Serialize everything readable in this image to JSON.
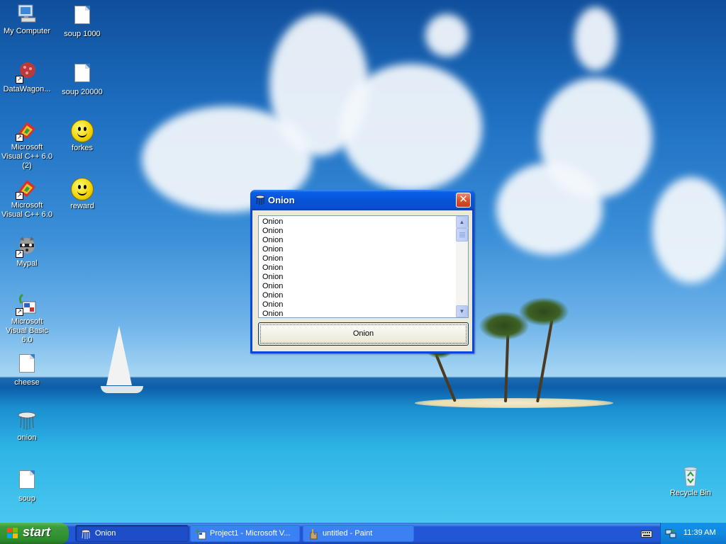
{
  "desktop": {
    "icons": [
      {
        "label": "My Computer"
      },
      {
        "label": "soup 1000"
      },
      {
        "label": "DataWagon..."
      },
      {
        "label": "soup 20000"
      },
      {
        "label": "Microsoft Visual C++ 6.0 (2)"
      },
      {
        "label": "forkes"
      },
      {
        "label": "Microsoft Visual C++ 6.0"
      },
      {
        "label": "reward"
      },
      {
        "label": "Mypal"
      },
      {
        "label": "Microsoft Visual Basic 6.0"
      },
      {
        "label": "cheese"
      },
      {
        "label": "onion"
      },
      {
        "label": "soup"
      },
      {
        "label": "Recycle Bin"
      }
    ]
  },
  "window": {
    "title": "Onion",
    "close_symbol": "✕",
    "list_items": [
      "Onion",
      "Onion",
      "Onion",
      "Onion",
      "Onion",
      "Onion",
      "Onion",
      "Onion",
      "Onion",
      "Onion",
      "Onion"
    ],
    "button_label": "Onion"
  },
  "taskbar": {
    "start_label": "start",
    "tasks": [
      {
        "label": "Onion",
        "active": true
      },
      {
        "label": "Project1 - Microsoft V...",
        "active": false
      },
      {
        "label": "untitled - Paint",
        "active": false
      }
    ],
    "clock": "11:39 AM"
  },
  "colors": {
    "titlebar": "#0853d8",
    "start_green": "#3c9c3c",
    "taskbar_blue": "#2157d7",
    "tray_blue": "#0e8ae0",
    "close_red": "#d9532c"
  }
}
